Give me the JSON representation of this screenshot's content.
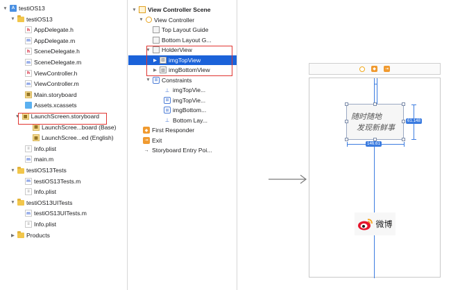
{
  "navigator": {
    "items": [
      {
        "label": "testiOS13",
        "indent": 0,
        "icon": "project",
        "disclosure": "open"
      },
      {
        "label": "testiOS13",
        "indent": 1,
        "icon": "folder",
        "disclosure": "open"
      },
      {
        "label": "AppDelegate.h",
        "indent": 2,
        "icon": "h",
        "disclosure": ""
      },
      {
        "label": "AppDelegate.m",
        "indent": 2,
        "icon": "m",
        "disclosure": ""
      },
      {
        "label": "SceneDelegate.h",
        "indent": 2,
        "icon": "h",
        "disclosure": ""
      },
      {
        "label": "SceneDelegate.m",
        "indent": 2,
        "icon": "m",
        "disclosure": ""
      },
      {
        "label": "ViewController.h",
        "indent": 2,
        "icon": "h",
        "disclosure": ""
      },
      {
        "label": "ViewController.m",
        "indent": 2,
        "icon": "m",
        "disclosure": ""
      },
      {
        "label": "Main.storyboard",
        "indent": 2,
        "icon": "storyboard",
        "disclosure": ""
      },
      {
        "label": "Assets.xcassets",
        "indent": 2,
        "icon": "assets",
        "disclosure": ""
      },
      {
        "label": "LaunchScreen.storyboard",
        "indent": 1.6,
        "icon": "storyboard",
        "disclosure": "open"
      },
      {
        "label": "LaunchScree...board (Base)",
        "indent": 3,
        "icon": "storyboard",
        "disclosure": ""
      },
      {
        "label": "LaunchScree...ed (English)",
        "indent": 3,
        "icon": "storyboard",
        "disclosure": ""
      },
      {
        "label": "Info.plist",
        "indent": 2,
        "icon": "plist",
        "disclosure": ""
      },
      {
        "label": "main.m",
        "indent": 2,
        "icon": "m",
        "disclosure": ""
      },
      {
        "label": "testiOS13Tests",
        "indent": 1,
        "icon": "folder",
        "disclosure": "open"
      },
      {
        "label": "testiOS13Tests.m",
        "indent": 2,
        "icon": "m",
        "disclosure": ""
      },
      {
        "label": "Info.plist",
        "indent": 2,
        "icon": "plist",
        "disclosure": ""
      },
      {
        "label": "testiOS13UITests",
        "indent": 1,
        "icon": "folder",
        "disclosure": "open"
      },
      {
        "label": "testiOS13UITests.m",
        "indent": 2,
        "icon": "m",
        "disclosure": ""
      },
      {
        "label": "Info.plist",
        "indent": 2,
        "icon": "plist",
        "disclosure": ""
      },
      {
        "label": "Products",
        "indent": 1,
        "icon": "folder",
        "disclosure": "closed"
      }
    ]
  },
  "outline": {
    "items": [
      {
        "label": "View Controller Scene",
        "indent": 0,
        "icon": "scene",
        "disclosure": "open",
        "bold": true,
        "selected": false
      },
      {
        "label": "View Controller",
        "indent": 1,
        "icon": "viewcontroller",
        "disclosure": "open",
        "bold": false,
        "selected": false
      },
      {
        "label": "Top Layout Guide",
        "indent": 2,
        "icon": "view",
        "disclosure": "",
        "bold": false,
        "selected": false
      },
      {
        "label": "Bottom Layout G...",
        "indent": 2,
        "icon": "view",
        "disclosure": "",
        "bold": false,
        "selected": false
      },
      {
        "label": "HolderView",
        "indent": 2,
        "icon": "view",
        "disclosure": "open",
        "bold": false,
        "selected": false
      },
      {
        "label": "imgTopView",
        "indent": 3,
        "icon": "image",
        "disclosure": "closed",
        "bold": false,
        "selected": true
      },
      {
        "label": "imgBottomView",
        "indent": 3,
        "icon": "image",
        "disclosure": "closed",
        "bold": false,
        "selected": false
      },
      {
        "label": "Constraints",
        "indent": 2,
        "icon": "constraints",
        "disclosure": "open",
        "bold": false,
        "selected": false
      },
      {
        "label": "imgTopVie...",
        "indent": 3.6,
        "icon": "constraint",
        "disclosure": "",
        "bold": false,
        "selected": false
      },
      {
        "label": "imgTopVie...",
        "indent": 3.6,
        "icon": "constraint-box",
        "disclosure": "",
        "bold": false,
        "selected": false
      },
      {
        "label": "imgBottom...",
        "indent": 3.6,
        "icon": "constraint-box",
        "disclosure": "",
        "bold": false,
        "selected": false
      },
      {
        "label": "Bottom Lay...",
        "indent": 3.6,
        "icon": "constraint",
        "disclosure": "",
        "bold": false,
        "selected": false
      },
      {
        "label": "First Responder",
        "indent": 0.6,
        "icon": "cube",
        "disclosure": "",
        "bold": false,
        "selected": false
      },
      {
        "label": "Exit",
        "indent": 0.6,
        "icon": "exit",
        "disclosure": "",
        "bold": false,
        "selected": false
      },
      {
        "label": "Storyboard Entry Poi...",
        "indent": 0.6,
        "icon": "arrow",
        "disclosure": "",
        "bold": false,
        "selected": false
      }
    ]
  },
  "canvas": {
    "top_image_text_line1": "随时随地",
    "top_image_text_line2": "发现新鲜事",
    "height_badge": "61.148",
    "width_badge": "146.61",
    "bottom_image_text": "微博"
  },
  "colors": {
    "selection": "#1b62d9",
    "highlight_box": "#e0332f",
    "constraint": "#3a7be0",
    "weibo_red": "#e6162d",
    "weibo_orange": "#f5a623"
  }
}
